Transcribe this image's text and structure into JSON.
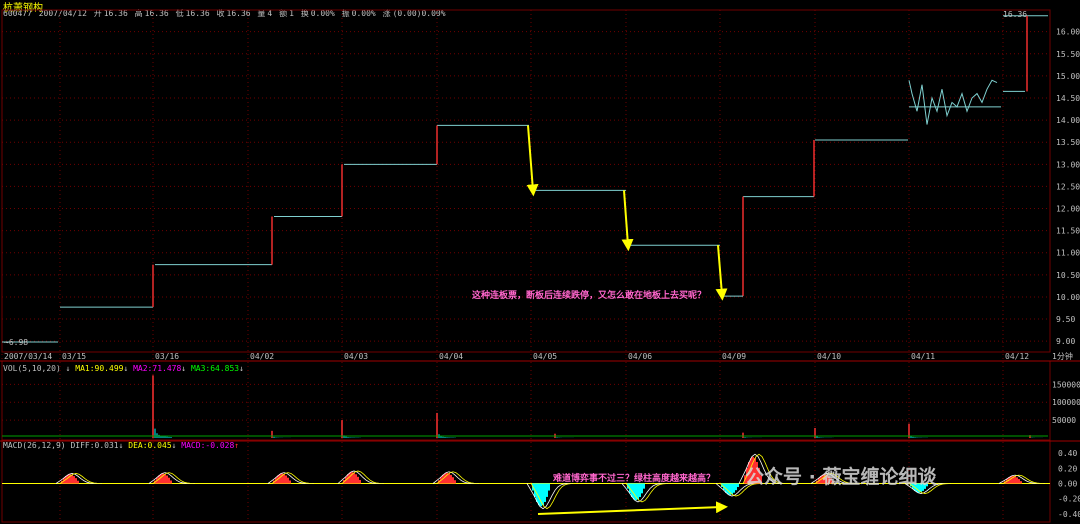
{
  "header": {
    "stock_name": "杭萧钢构",
    "code": "600477",
    "date": "2007/04/12",
    "open_label": "开",
    "open": "16.36",
    "high_label": "高",
    "high": "16.36",
    "low_label": "低",
    "low": "16.36",
    "close_label": "收",
    "close": "16.36",
    "volume_label": "量",
    "volume": "4",
    "amount_label": "额",
    "amount": "1",
    "turnover_label": "换",
    "turnover": "0.00%",
    "amplitude_label": "振",
    "amplitude": "0.00%",
    "change_label": "涨",
    "change": "(0.00)0.00%"
  },
  "price_panel": {
    "last_price_label": "16.36",
    "low_marker": "~6.98",
    "y_ticks": [
      "16.00",
      "15.50",
      "15.00",
      "14.50",
      "14.00",
      "13.50",
      "13.00",
      "12.50",
      "12.00",
      "11.50",
      "11.00",
      "10.50",
      "10.00",
      "9.50",
      "9.00"
    ],
    "annotation": "这种连板票，断板后连续跌停，又怎么敢在地板上去买呢？"
  },
  "x_axis": {
    "labels": [
      "2007/03/14",
      "03/15",
      "03/16",
      "04/02",
      "04/03",
      "04/04",
      "04/05",
      "04/06",
      "04/09",
      "04/10",
      "04/11",
      "04/12"
    ],
    "period": "1分钟"
  },
  "volume_panel": {
    "header_prefix": "VOL(5,10,20)",
    "ma1": "MA1:90.499",
    "ma2": "MA2:71.478",
    "ma3": "MA3:64.853",
    "y_ticks": [
      "150000",
      "100000",
      "50000"
    ]
  },
  "macd_panel": {
    "header_prefix": "MACD(26,12,9)",
    "diff": "DIFF:0.031",
    "dea": "DEA:0.045",
    "macd": "MACD:-0.028",
    "y_ticks": [
      "0.40",
      "0.20",
      "0.00",
      "-0.20",
      "-0.40"
    ],
    "annotation": "难道博弈事不过三？绿柱高度越来越高？"
  },
  "watermark": "公众号 · 薇宝缠论细谈",
  "colors": {
    "grid": "#700000",
    "price_line": "#7fd0d0",
    "up": "#ff3030",
    "down": "#00ffff",
    "ma1": "#ffffff",
    "ma2": "#ffff00",
    "ma3": "#ff00ff",
    "arrow": "#ffff00"
  },
  "chart_data": {
    "type": "line",
    "title": "",
    "x": [
      "2007/03/14",
      "03/15",
      "03/16",
      "04/02",
      "04/03",
      "04/04",
      "04/05",
      "04/06",
      "04/09",
      "04/10",
      "04/11",
      "04/12"
    ],
    "series": [
      {
        "values": [
          8.98,
          9.77,
          10.73,
          11.82,
          13.0,
          13.88,
          12.41,
          11.17,
          12.27,
          13.55,
          14.3,
          16.36
        ]
      }
    ],
    "ylim": [
      8.8,
      16.4
    ]
  }
}
